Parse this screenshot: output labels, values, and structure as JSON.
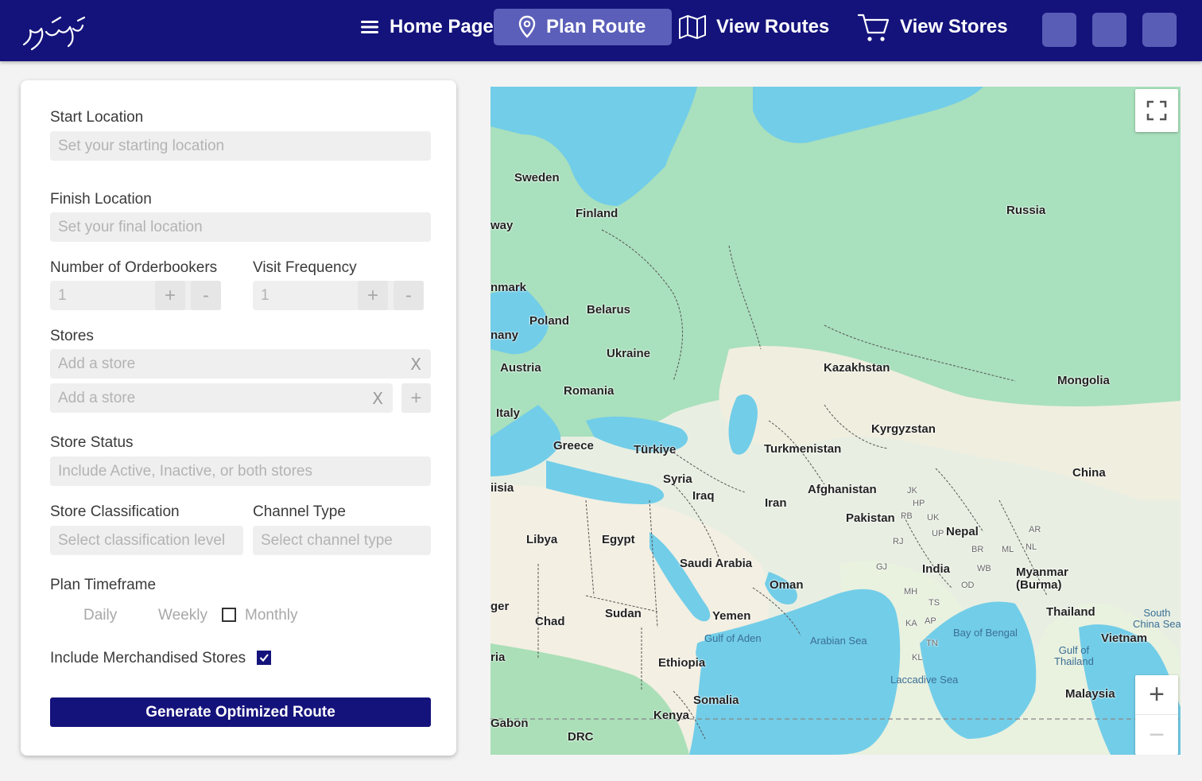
{
  "nav": {
    "logo_text": "رہ گزر",
    "home_label": "Home Page",
    "plan_label": "Plan Route",
    "view_routes_label": "View Routes",
    "view_stores_label": "View Stores"
  },
  "form": {
    "start_label": "Start Location",
    "start_placeholder": "Set  your starting location",
    "finish_label": "Finish  Location",
    "finish_placeholder": "Set  your final location",
    "orderbookers_label": "Number of Orderbookers",
    "orderbookers_value": "1",
    "frequency_label": "Visit Frequency",
    "frequency_value": "1",
    "plus": "+",
    "minus": "-",
    "stores_label": "Stores",
    "store_placeholder": "Add a store",
    "clear": "X",
    "status_label": "Store Status",
    "status_placeholder": "Include Active, Inactive, or both stores",
    "classification_label": "Store Classification",
    "classification_placeholder": "Select classification level",
    "channel_label": "Channel Type",
    "channel_placeholder": "Select channel type",
    "timeframe_label": "Plan Timeframe",
    "timeframe_options": [
      "Daily",
      "Weekly",
      "Monthly"
    ],
    "timeframe_monthly_checked": false,
    "merch_label": "Include Merchandised Stores",
    "merch_checked": true,
    "generate_label": "Generate Optimized Route"
  },
  "map": {
    "labels": {
      "sweden": "Sweden",
      "finland": "Finland",
      "russia": "Russia",
      "norway": "way",
      "denmark": "nmark",
      "poland": "Poland",
      "belarus": "Belarus",
      "germany": "nany",
      "ukraine": "Ukraine",
      "austria": "Austria",
      "romania": "Romania",
      "kazakhstan": "Kazakhstan",
      "mongolia": "Mongolia",
      "italy": "Italy",
      "kyrgyzstan": "Kyrgyzstan",
      "greece": "Greece",
      "turkiye": "Türkiye",
      "turkmenistan": "Turkmenistan",
      "china": "China",
      "tunisia": "iisia",
      "syria": "Syria",
      "iraq": "Iraq",
      "iran": "Iran",
      "afghanistan": "Afghanistan",
      "pakistan": "Pakistan",
      "nepal": "Nepal",
      "libya": "Libya",
      "egypt": "Egypt",
      "saudi": "Saudi Arabia",
      "oman": "Oman",
      "india": "India",
      "myanmar": "Myanmar\n(Burma)",
      "niger": "ger",
      "chad": "Chad",
      "sudan": "Sudan",
      "yemen": "Yemen",
      "thailand": "Thailand",
      "vietnam": "Vietnam",
      "nigeria": "ria",
      "ethiopia": "Ethiopia",
      "somalia": "Somalia",
      "malaysia": "Malaysia",
      "gabon": "Gabon",
      "kenya": "Kenya",
      "drc": "DRC",
      "gulf_aden": "Gulf of Aden",
      "arabian_sea": "Arabian Sea",
      "bay_bengal": "Bay of Bengal",
      "laccadive": "Laccadive Sea",
      "gulf_thailand": "Gulf of\nThailand",
      "south_china_sea": "South\nChina Sea",
      "jk": "JK",
      "hp": "HP",
      "pb": "PB",
      "uk": "UK",
      "up": "UP",
      "rj": "RJ",
      "gj": "GJ",
      "mh": "MH",
      "ts": "TS",
      "ka": "KA",
      "ap": "AP",
      "tn": "TN",
      "kl": "KL",
      "od": "OD",
      "wb": "WB",
      "br": "BR",
      "ml": "ML",
      "nl": "NL",
      "ar": "AR"
    },
    "zoom_in": "+",
    "zoom_out": "−"
  },
  "colors": {
    "brand": "#14137c",
    "active_nav": "#5b5fb9",
    "water": "#72cde8",
    "land_green": "#a8dfb8",
    "land_desert": "#f5f0e3"
  }
}
